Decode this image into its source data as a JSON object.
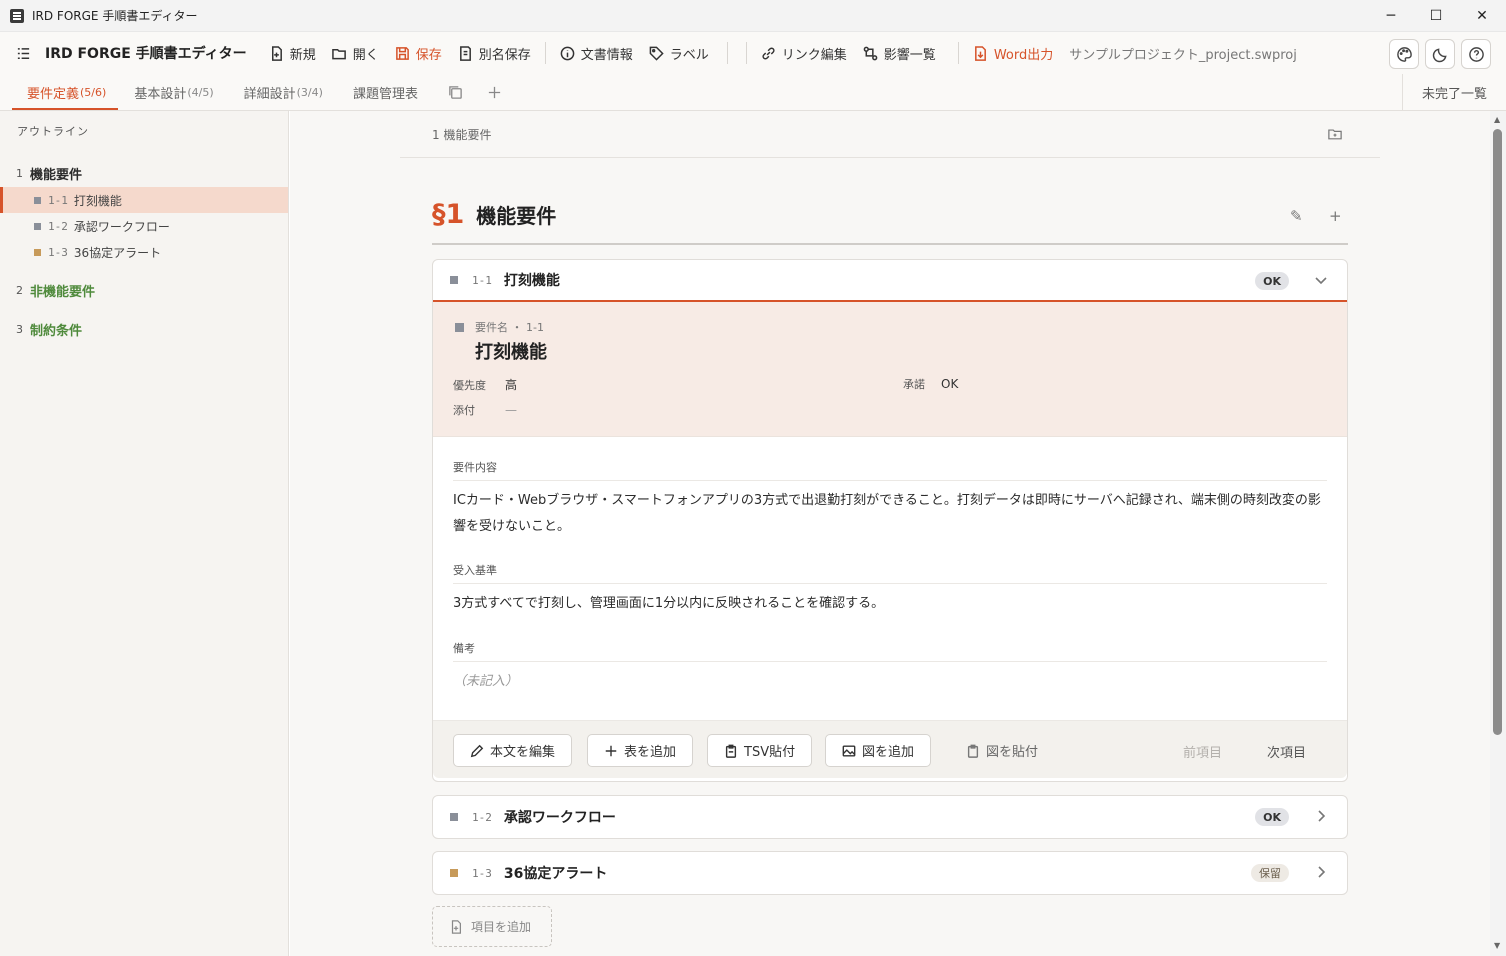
{
  "window": {
    "title": "IRD FORGE 手順書エディター",
    "controls": [
      "─",
      "☐",
      "✕"
    ]
  },
  "toolbar": {
    "brand": "IRD FORGE 手順書エディター",
    "new": "新規",
    "open": "開く",
    "save": "保存",
    "save_as": "別名保存",
    "doc_info": "文書情報",
    "label": "ラベル",
    "link_edit": "リンク編集",
    "impact": "影響一覧",
    "word_export": "Word出力",
    "project": "サンプルプロジェクト_project.swproj",
    "accent": "#d6532a"
  },
  "tabs": [
    {
      "label": "要件定義",
      "count": "(5/6)"
    },
    {
      "label": "基本設計",
      "count": "(4/5)"
    },
    {
      "label": "詳細設計",
      "count": "(3/4)"
    },
    {
      "label": "課題管理表",
      "count": ""
    }
  ],
  "incomplete_list": "未完了一覧",
  "outline": {
    "heading": "アウトライン",
    "sections": [
      {
        "num": "1",
        "label": "機能要件",
        "color": "#2b2b2b"
      },
      {
        "num": "2",
        "label": "非機能要件",
        "color": "#4f8a3c"
      },
      {
        "num": "3",
        "label": "制約条件",
        "color": "#4f8a3c"
      }
    ],
    "items": [
      {
        "id": "1-1",
        "label": "打刻機能",
        "color": "#8a8f99"
      },
      {
        "id": "1-2",
        "label": "承認ワークフロー",
        "color": "#8a8f99"
      },
      {
        "id": "1-3",
        "label": "36協定アラート",
        "color": "#c79a5a"
      }
    ]
  },
  "main": {
    "breadcrumb": "1 機能要件",
    "section_symbol": "§1",
    "section_title": "機能要件",
    "cards": [
      {
        "id": "1-1",
        "name": "打刻機能",
        "status": "OK",
        "color": "#8a8f99"
      },
      {
        "id": "1-2",
        "name": "承認ワークフロー",
        "status": "OK",
        "color": "#8a8f99"
      },
      {
        "id": "1-3",
        "name": "36協定アラート",
        "status": "保留",
        "color": "#c79a5a"
      }
    ],
    "detail": {
      "mini": "要件名 ・ 1-1",
      "name": "打刻機能",
      "priority_label": "優先度",
      "priority": "高",
      "approval_label": "承諾",
      "approval": "OK",
      "attach_label": "添付",
      "attach": "—",
      "content_label": "要件内容",
      "content": "ICカード・Webブラウザ・スマートフォンアプリの3方式で出退勤打刻ができること。打刻データは即時にサーバへ記録され、端末側の時刻改変の影響を受けないこと。",
      "acceptance_label": "受入基準",
      "acceptance": "3方式すべてで打刻し、管理画面に1分以内に反映されることを確認する。",
      "notes_label": "備考",
      "notes": "（未記入）"
    },
    "footer": {
      "edit_body": "本文を編集",
      "add_table": "表を追加",
      "tsv_paste": "TSV貼付",
      "add_figure": "図を追加",
      "paste_figure": "図を貼付",
      "prev": "前項目",
      "next": "次項目"
    },
    "add_item": "項目を追加"
  }
}
